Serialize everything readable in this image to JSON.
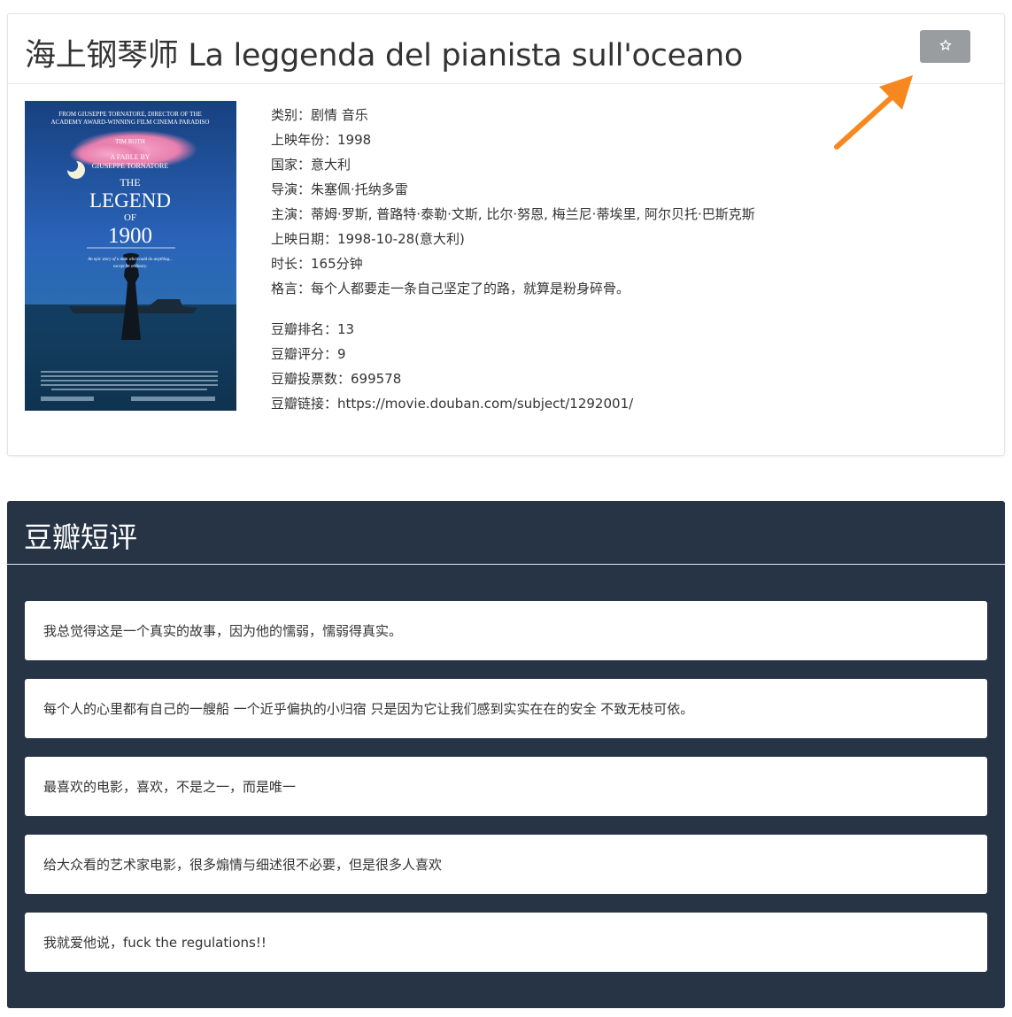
{
  "movie": {
    "title": "海上钢琴师 La leggenda del pianista sull'oceano",
    "favorite_icon": "star-outline-icon",
    "poster": {
      "top_text_1": "FROM GIUSEPPE TORNATORE, DIRECTOR OF THE",
      "top_text_2": "ACADEMY AWARD-WINNING FILM CINEMA PARADISO",
      "actor": "TIM ROTH",
      "fable_1": "A FABLE BY",
      "fable_2": "GIUSEPPE TORNATORE",
      "the": "THE",
      "legend": "LEGEND",
      "of": "OF",
      "year": "1900",
      "tagline_1": "An epic story of a man who could do anything...",
      "tagline_2": "except be ordinary."
    },
    "info": [
      "类别：剧情 音乐",
      "上映年份：1998",
      "国家：意大利",
      "导演：朱塞佩·托纳多雷",
      "主演：蒂姆·罗斯, 普路特·泰勒·文斯, 比尔·努恩, 梅兰尼·蒂埃里, 阿尔贝托·巴斯克斯",
      "上映日期：1998-10-28(意大利)",
      "时长：165分钟",
      "格言：每个人都要走一条自己坚定了的路，就算是粉身碎骨。"
    ],
    "douban": [
      "豆瓣排名：13",
      "豆瓣评分：9",
      "豆瓣投票数：699578",
      "豆瓣链接：https://movie.douban.com/subject/1292001/"
    ]
  },
  "reviews": {
    "title": "豆瓣短评",
    "items": [
      "我总觉得这是一个真实的故事，因为他的懦弱，懦弱得真实。",
      "每个人的心里都有自己的一艘船 一个近乎偏执的小归宿 只是因为它让我们感到实实在在的安全 不致无枝可依。",
      "最喜欢的电影，喜欢，不是之一，而是唯一",
      "给大众看的艺术家电影，很多煽情与细述很不必要，但是很多人喜欢",
      "我就爱他说，fuck the regulations!!"
    ]
  },
  "colors": {
    "reviews_bg": "#263445",
    "button_gray": "#9a9da0",
    "arrow_orange": "#f7881f"
  }
}
